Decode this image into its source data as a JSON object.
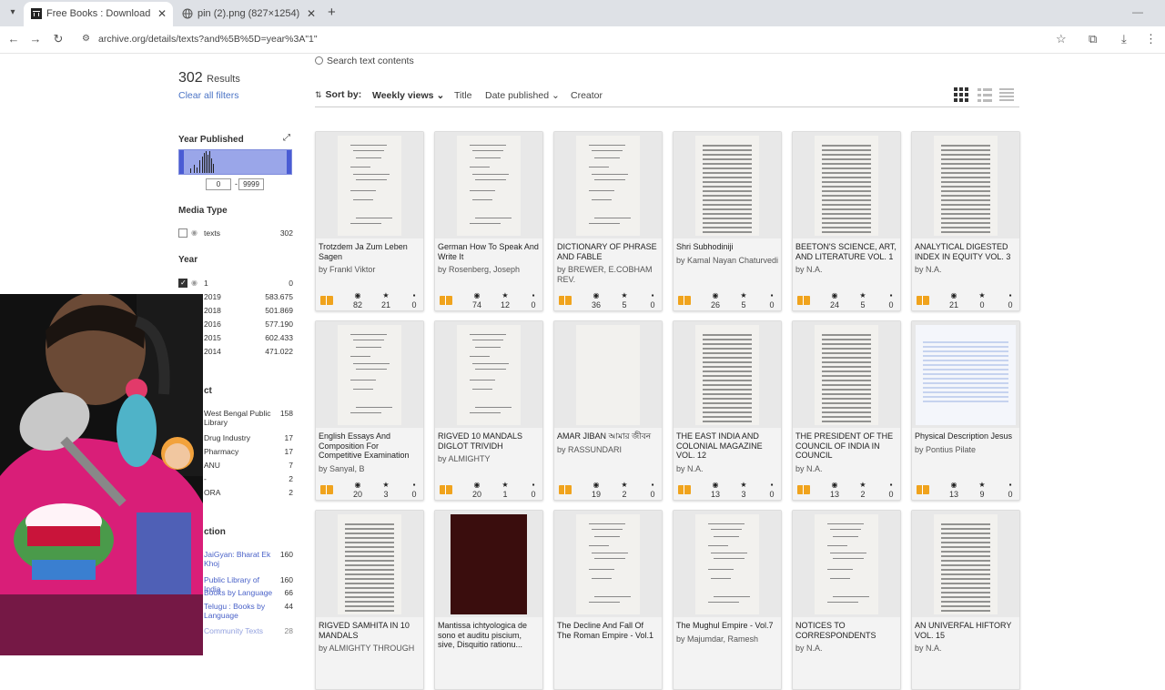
{
  "browser": {
    "tabs": [
      {
        "title": "Free Books : Download & Strea",
        "active": true
      },
      {
        "title": "pin (2).png (827×1254)",
        "active": false
      }
    ],
    "url": "archive.org/details/texts?and%5B%5D=year%3A\"1\""
  },
  "sidebar": {
    "results_count": "302",
    "results_label": "Results",
    "clear_filters": "Clear all filters",
    "year_published_heading": "Year Published",
    "year_min": "0",
    "year_max": "9999",
    "media_type_heading": "Media Type",
    "media_types": [
      {
        "label": "texts",
        "count": "302",
        "checked": false
      }
    ],
    "year_heading": "Year",
    "years": [
      {
        "label": "1",
        "count": "0",
        "checked": true
      },
      {
        "label": "2019",
        "count": "583.675"
      },
      {
        "label": "2018",
        "count": "501.869"
      },
      {
        "label": "2016",
        "count": "577.190"
      },
      {
        "label": "2015",
        "count": "602.433"
      },
      {
        "label": "2014",
        "count": "471.022"
      }
    ],
    "subject_heading_partial": "ct",
    "subjects": [
      {
        "label": "West Bengal Public Library",
        "count": "158"
      },
      {
        "label": "Drug Industry",
        "count": "17"
      },
      {
        "label": "Pharmacy",
        "count": "17"
      },
      {
        "label": "ANU",
        "count": "7"
      },
      {
        "label": "-",
        "count": "2"
      },
      {
        "label": "ORA",
        "count": "2"
      }
    ],
    "collection_heading_partial": "ction",
    "collections": [
      {
        "label": "JaiGyan: Bharat Ek Khoj",
        "count": "160"
      },
      {
        "label": "Public Library of India",
        "count": "160"
      },
      {
        "label": "Books by Language",
        "count": "66"
      },
      {
        "label": "Telugu : Books by Language",
        "count": "44"
      },
      {
        "label": "Community Texts",
        "count": "28"
      }
    ]
  },
  "search": {
    "label": "Search text contents"
  },
  "sort": {
    "label": "Sort by:",
    "options": [
      "Weekly views",
      "Title",
      "Date published",
      "Creator"
    ]
  },
  "items": [
    {
      "title": "Trotzdem Ja Zum Leben Sagen",
      "by": "by Frankl Viktor",
      "views": "82",
      "favs": "21",
      "reviews": "0"
    },
    {
      "title": "German How To Speak And Write It",
      "by": "by Rosenberg, Joseph",
      "views": "74",
      "favs": "12",
      "reviews": "0"
    },
    {
      "title": "DICTIONARY OF PHRASE AND FABLE",
      "by": "by BREWER, E.COBHAM REV.",
      "views": "36",
      "favs": "5",
      "reviews": "0"
    },
    {
      "title": "Shri Subhodiniji",
      "by": "by Kamal Nayan Chaturvedi",
      "views": "26",
      "favs": "5",
      "reviews": "0"
    },
    {
      "title": "BEETON'S SCIENCE, ART, AND LITERATURE VOL. 1",
      "by": "by N.A.",
      "views": "24",
      "favs": "5",
      "reviews": "0"
    },
    {
      "title": "ANALYTICAL DIGESTED INDEX IN EQUITY VOL. 3",
      "by": "by N.A.",
      "views": "21",
      "favs": "0",
      "reviews": "0"
    },
    {
      "title": "English Essays And Composition For Competitive Examination",
      "by": "by Sanyal, B",
      "views": "20",
      "favs": "3",
      "reviews": "0"
    },
    {
      "title": "RIGVED 10 MANDALS DIGLOT TRIVIDH",
      "by": "by ALMIGHTY",
      "views": "20",
      "favs": "1",
      "reviews": "0"
    },
    {
      "title": "AMAR JIBAN আমার জীবন",
      "by": "by RASSUNDARI",
      "views": "19",
      "favs": "2",
      "reviews": "0"
    },
    {
      "title": "THE EAST INDIA AND COLONIAL MAGAZINE VOL. 12",
      "by": "by N.A.",
      "views": "13",
      "favs": "3",
      "reviews": "0"
    },
    {
      "title": "THE PRESIDENT OF THE COUNCIL OF INDIA IN COUNCIL",
      "by": "by N.A.",
      "views": "13",
      "favs": "2",
      "reviews": "0"
    },
    {
      "title": "Physical Description Jesus",
      "by": "by Pontius Pilate",
      "views": "13",
      "favs": "9",
      "reviews": "0"
    },
    {
      "title": "RIGVED SAMHITA IN 10 MANDALS",
      "by": "by ALMIGHTY THROUGH"
    },
    {
      "title": "Mantissa ichtyologica de sono et auditu piscium, sive, Disquitio rationu...",
      "by": ""
    },
    {
      "title": "The Decline And Fall Of The Roman Empire - Vol.1",
      "by": ""
    },
    {
      "title": "The Mughul Empire - Vol.7",
      "by": "by Majumdar, Ramesh"
    },
    {
      "title": "NOTICES TO CORRESPONDENTS",
      "by": "by N.A."
    },
    {
      "title": "AN UNIVERFAL HIFTORY VOL. 15",
      "by": "by N.A."
    }
  ]
}
